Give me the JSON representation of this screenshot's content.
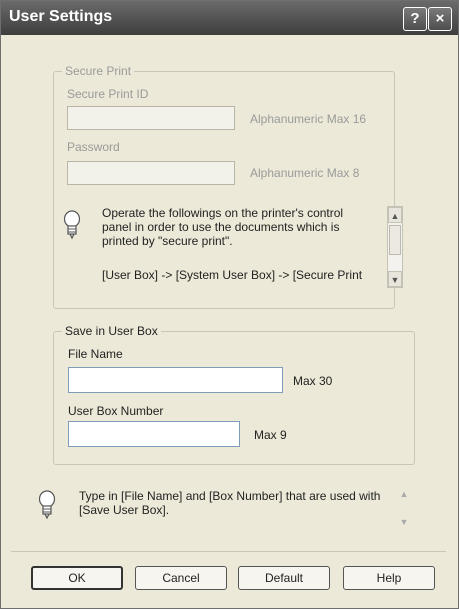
{
  "window": {
    "title": "User Settings",
    "help_btn": "?",
    "close_btn": "×"
  },
  "secure_print": {
    "legend": "Secure Print",
    "id_label": "Secure Print ID",
    "id_value": "",
    "id_hint": "Alphanumeric Max 16",
    "password_label": "Password",
    "password_value": "",
    "password_hint": "Alphanumeric Max 8",
    "info_text": "Operate the followings on the printer's control panel in order to use the documents which is printed by \"secure print\".",
    "info_path": "[User Box] -> [System User Box] -> [Secure Print"
  },
  "save_box": {
    "legend": "Save in User Box",
    "file_name_label": "File Name",
    "file_name_value": "",
    "file_name_hint": "Max 30",
    "box_number_label": "User Box Number",
    "box_number_value": "",
    "box_number_hint": "Max 9"
  },
  "bottom_note": "Type in [File Name] and [Box Number] that are used with [Save User Box].",
  "buttons": {
    "ok": "OK",
    "cancel": "Cancel",
    "default": "Default",
    "help": "Help"
  }
}
